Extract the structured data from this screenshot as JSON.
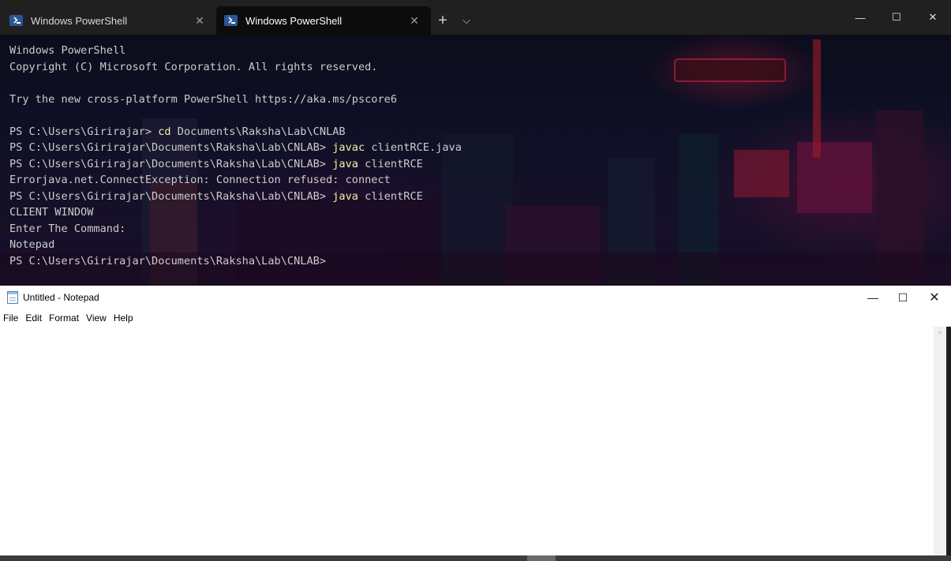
{
  "terminal": {
    "tabs": [
      {
        "title": "Windows PowerShell",
        "close": "✕"
      },
      {
        "title": "Windows PowerShell",
        "close": "✕"
      }
    ],
    "new_tab": "+",
    "dropdown": "⌵",
    "window_controls": {
      "minimize": "—",
      "maximize": "☐",
      "close": "✕"
    },
    "lines": [
      {
        "text": "Windows PowerShell"
      },
      {
        "text": "Copyright (C) Microsoft Corporation. All rights reserved."
      },
      {
        "text": ""
      },
      {
        "text": "Try the new cross-platform PowerShell https://aka.ms/pscore6"
      },
      {
        "text": ""
      },
      {
        "prompt": "PS C:\\Users\\Girirajar> ",
        "cmd": "cd",
        "args": " Documents\\Raksha\\Lab\\CNLAB"
      },
      {
        "prompt": "PS C:\\Users\\Girirajar\\Documents\\Raksha\\Lab\\CNLAB> ",
        "cmd": "javac",
        "args": " clientRCE.java"
      },
      {
        "prompt": "PS C:\\Users\\Girirajar\\Documents\\Raksha\\Lab\\CNLAB> ",
        "cmd": "java",
        "args": " clientRCE"
      },
      {
        "text": "Errorjava.net.ConnectException: Connection refused: connect"
      },
      {
        "prompt": "PS C:\\Users\\Girirajar\\Documents\\Raksha\\Lab\\CNLAB> ",
        "cmd": "java",
        "args": " clientRCE"
      },
      {
        "text": "CLIENT WINDOW"
      },
      {
        "text": "Enter The Command:"
      },
      {
        "text": "Notepad"
      },
      {
        "text": "PS C:\\Users\\Girirajar\\Documents\\Raksha\\Lab\\CNLAB>"
      }
    ],
    "colors": {
      "text": "#cccccc",
      "command": "#f9f1a5",
      "background": "#0c0c0c"
    }
  },
  "notepad": {
    "title": "Untitled - Notepad",
    "window_controls": {
      "minimize": "—",
      "maximize": "☐",
      "close": "✕"
    },
    "menu": [
      "File",
      "Edit",
      "Format",
      "View",
      "Help"
    ],
    "content": "",
    "scroll_up": "^"
  }
}
